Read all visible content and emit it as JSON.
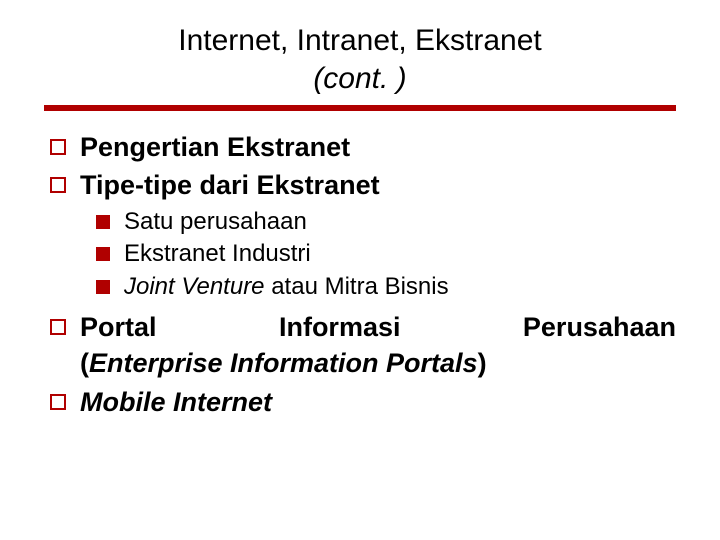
{
  "title": {
    "line1": "Internet, Intranet, Ekstranet",
    "line2": "(cont. )"
  },
  "items": {
    "l1a": "Pengertian Ekstranet",
    "l1b": "Tipe-tipe dari Ekstranet",
    "l2a": "Satu perusahaan",
    "l2b": "Ekstranet Industri",
    "l2c_italic": "Joint Venture",
    "l2c_plain": " atau Mitra Bisnis",
    "l1c_plain1": "Portal",
    "l1c_plain2": "Informasi",
    "l1c_plain3": "Perusahaan",
    "l1c_sub_open": "(",
    "l1c_sub_italic": "Enterprise Information Portals",
    "l1c_sub_close": ")",
    "l1d": "Mobile Internet"
  },
  "colors": {
    "accent": "#b00000"
  }
}
